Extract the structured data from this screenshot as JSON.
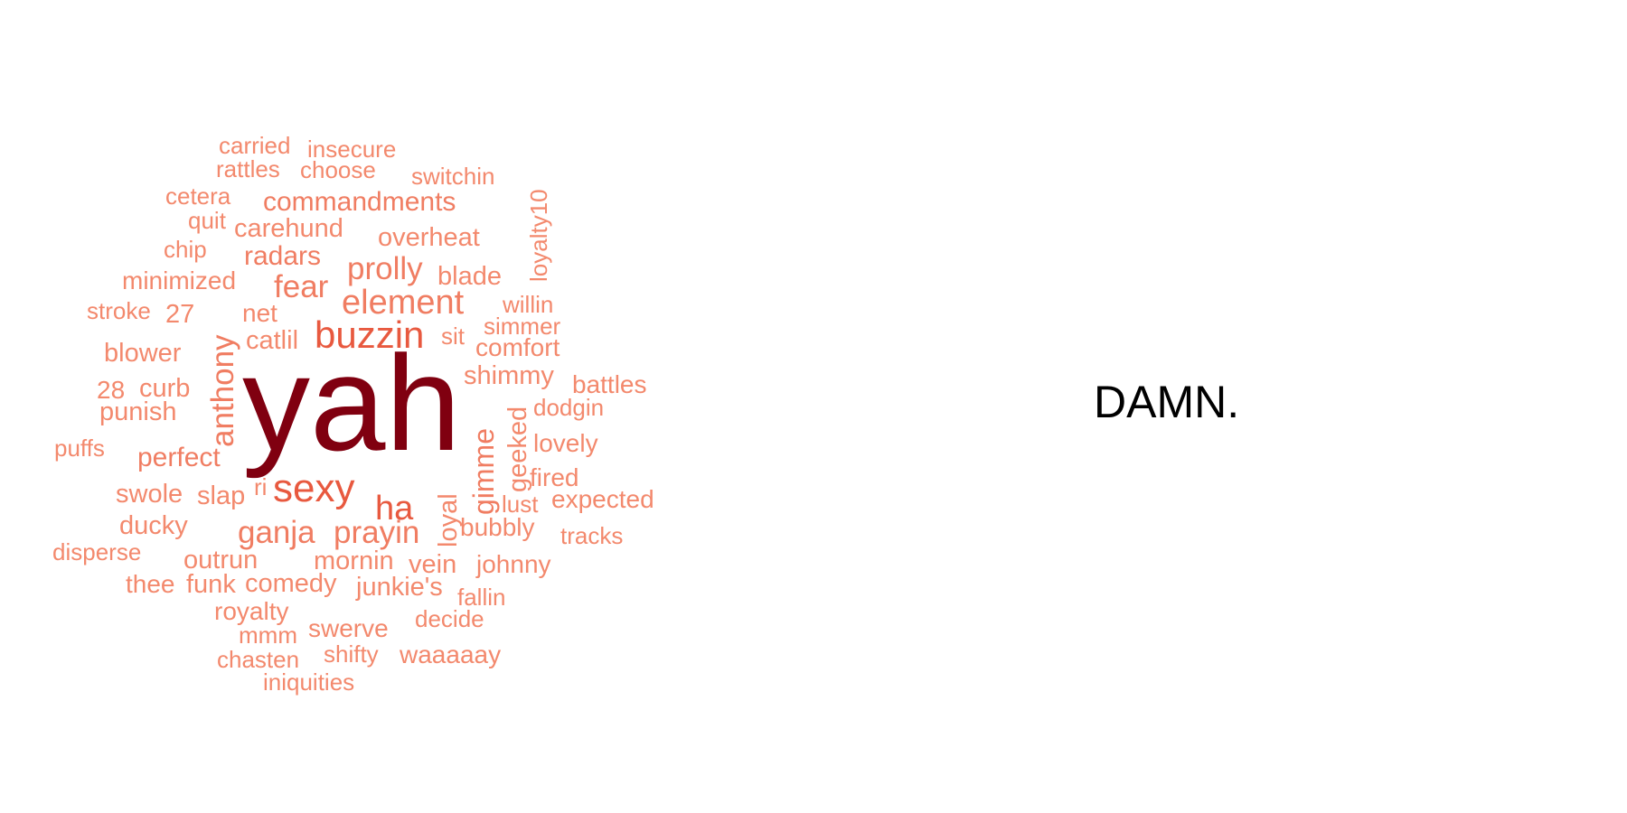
{
  "album_title": "DAMN.",
  "palette": {
    "top": "#800010",
    "high": "#e8593f",
    "mid": "#f07d62",
    "low": "#f3896d"
  },
  "words": [
    {
      "text": "yah",
      "weight": 10
    },
    {
      "text": "sexy",
      "weight": 4
    },
    {
      "text": "ha",
      "weight": 3
    },
    {
      "text": "buzzin",
      "weight": 3
    },
    {
      "text": "element",
      "weight": 2.6
    },
    {
      "text": "anthony",
      "weight": 2.4
    },
    {
      "text": "gimme",
      "weight": 2.2
    },
    {
      "text": "fear",
      "weight": 2.2
    },
    {
      "text": "prolly",
      "weight": 2.2
    },
    {
      "text": "ganja",
      "weight": 2.2
    },
    {
      "text": "prayin",
      "weight": 2.2
    },
    {
      "text": "radars",
      "weight": 2
    },
    {
      "text": "commandments",
      "weight": 2
    },
    {
      "text": "perfect",
      "weight": 2
    },
    {
      "text": "carried",
      "weight": 1.5
    },
    {
      "text": "insecure",
      "weight": 1.5
    },
    {
      "text": "rattles",
      "weight": 1.5
    },
    {
      "text": "choose",
      "weight": 1.5
    },
    {
      "text": "switchin",
      "weight": 1.5
    },
    {
      "text": "cetera",
      "weight": 1.5
    },
    {
      "text": "loyalty10",
      "weight": 1.5
    },
    {
      "text": "quit",
      "weight": 1.5
    },
    {
      "text": "carehund",
      "weight": 1.5
    },
    {
      "text": "overheat",
      "weight": 1.5
    },
    {
      "text": "chip",
      "weight": 1.5
    },
    {
      "text": "minimized",
      "weight": 1.5
    },
    {
      "text": "blade",
      "weight": 1.5
    },
    {
      "text": "stroke",
      "weight": 1.5
    },
    {
      "text": "27",
      "weight": 1.5
    },
    {
      "text": "net",
      "weight": 1.5
    },
    {
      "text": "willin",
      "weight": 1.5
    },
    {
      "text": "blower",
      "weight": 1.5
    },
    {
      "text": "catlil",
      "weight": 1.5
    },
    {
      "text": "sit",
      "weight": 1.5
    },
    {
      "text": "simmer",
      "weight": 1.5
    },
    {
      "text": "comfort",
      "weight": 1.5
    },
    {
      "text": "28",
      "weight": 1.5
    },
    {
      "text": "curb",
      "weight": 1.5
    },
    {
      "text": "shimmy",
      "weight": 1.5
    },
    {
      "text": "battles",
      "weight": 1.5
    },
    {
      "text": "punish",
      "weight": 1.5
    },
    {
      "text": "dodgin",
      "weight": 1.5
    },
    {
      "text": "geeked",
      "weight": 1.5
    },
    {
      "text": "puffs",
      "weight": 1.5
    },
    {
      "text": "lovely",
      "weight": 1.5
    },
    {
      "text": "fired",
      "weight": 1.5
    },
    {
      "text": "swole",
      "weight": 1.5
    },
    {
      "text": "slap",
      "weight": 1.5
    },
    {
      "text": "ri",
      "weight": 1.5
    },
    {
      "text": "loyal",
      "weight": 1.5
    },
    {
      "text": "lust",
      "weight": 1.5
    },
    {
      "text": "expected",
      "weight": 1.5
    },
    {
      "text": "ducky",
      "weight": 1.5
    },
    {
      "text": "bubbly",
      "weight": 1.5
    },
    {
      "text": "tracks",
      "weight": 1.5
    },
    {
      "text": "disperse",
      "weight": 1.5
    },
    {
      "text": "outrun",
      "weight": 1.5
    },
    {
      "text": "mornin",
      "weight": 1.5
    },
    {
      "text": "vein",
      "weight": 1.5
    },
    {
      "text": "johnny",
      "weight": 1.5
    },
    {
      "text": "thee",
      "weight": 1.5
    },
    {
      "text": "funk",
      "weight": 1.5
    },
    {
      "text": "comedy",
      "weight": 1.5
    },
    {
      "text": "junkie's",
      "weight": 1.5
    },
    {
      "text": "fallin",
      "weight": 1.5
    },
    {
      "text": "royalty",
      "weight": 1.5
    },
    {
      "text": "decide",
      "weight": 1.5
    },
    {
      "text": "mmm",
      "weight": 1.5
    },
    {
      "text": "swerve",
      "weight": 1.5
    },
    {
      "text": "chasten",
      "weight": 1.5
    },
    {
      "text": "shifty",
      "weight": 1.5
    },
    {
      "text": "waaaaay",
      "weight": 1.5
    },
    {
      "text": "iniquities",
      "weight": 1.5
    }
  ]
}
